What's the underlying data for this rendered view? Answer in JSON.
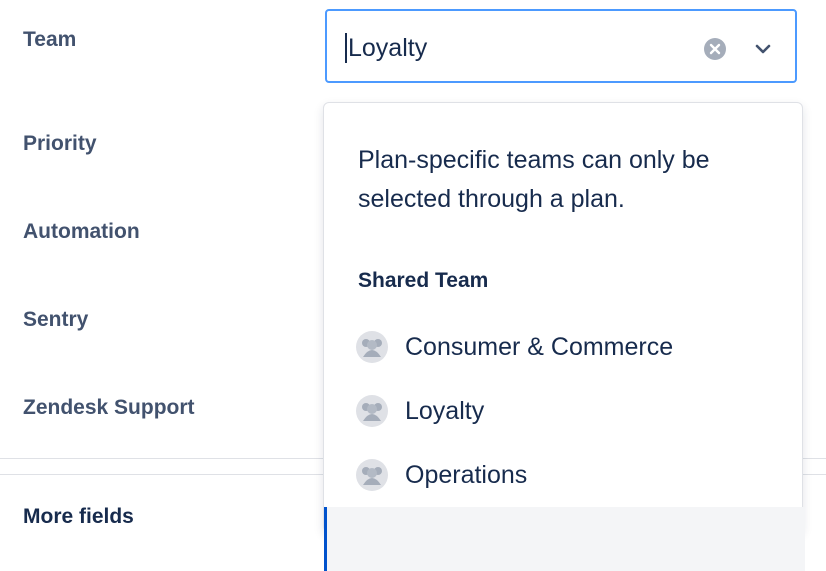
{
  "fields": {
    "team": "Team",
    "priority": "Priority",
    "automation": "Automation",
    "sentry": "Sentry",
    "zendesk": "Zendesk Support"
  },
  "team_select": {
    "value": "Loyalty",
    "clear_icon": "clear-icon",
    "chevron_icon": "chevron-down-icon",
    "focus_color": "#4c9aff"
  },
  "dropdown": {
    "notice": "Plan-specific teams can only be selected through a plan.",
    "group_heading": "Shared Team",
    "options": [
      {
        "label": "Consumer & Commerce",
        "icon": "team-icon"
      },
      {
        "label": "Loyalty",
        "icon": "team-icon"
      },
      {
        "label": "Operations",
        "icon": "team-icon"
      }
    ]
  },
  "more_fields": "More fields"
}
